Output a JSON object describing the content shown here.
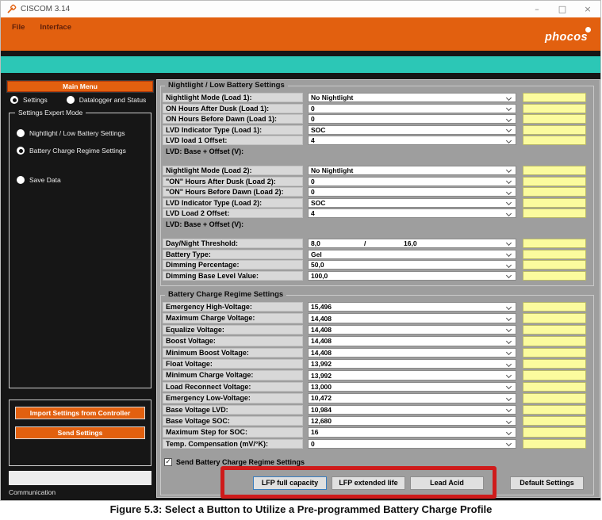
{
  "window": {
    "title": "CISCOM 3.14"
  },
  "titlebar_controls": {
    "minimize": "–",
    "maximize": "□",
    "close": "×"
  },
  "menubar": {
    "items": [
      "File",
      "Interface"
    ],
    "logo_text": "phocos"
  },
  "colors": {
    "accent_orange": "#e2600f",
    "teal": "#2cc7b6",
    "annotation_red": "#cf1b1b",
    "indicator_yellow": "#fbfb9e"
  },
  "sidebar": {
    "main_menu_label": "Main Menu",
    "mode_radios": [
      {
        "label": "Settings",
        "selected": true
      },
      {
        "label": "Datalogger and Status",
        "selected": false
      }
    ],
    "expert_group": {
      "title": "Settings Expert Mode",
      "radios": [
        {
          "label": "Nightlight / Low Battery Settings",
          "selected": false
        },
        {
          "label": "Battery Charge Regime Settings",
          "selected": true
        },
        {
          "label": "Save Data",
          "selected": false
        }
      ]
    },
    "action_buttons": [
      "Import Settings from Controller",
      "Send Settings"
    ],
    "communication_label": "Communication"
  },
  "main": {
    "group1": {
      "title": "Nightlight / Low Battery Settings",
      "sections": [
        {
          "rows": [
            {
              "label": "Nightlight Mode (Load 1):",
              "value": "No Nightlight"
            },
            {
              "label": "ON Hours After Dusk (Load 1):",
              "value": "0"
            },
            {
              "label": "ON Hours Before Dawn (Load 1):",
              "value": "0"
            },
            {
              "label": "LVD Indicator Type (Load 1):",
              "value": "SOC"
            },
            {
              "label": "LVD load 1 Offset:",
              "value": "4"
            },
            {
              "label": "LVD: Base + Offset (V):",
              "plain": true
            }
          ]
        },
        {
          "rows": [
            {
              "label": "Nightlight Mode (Load 2):",
              "value": "No Nightlight"
            },
            {
              "label": "\"ON\" Hours After Dusk (Load 2):",
              "value": "0"
            },
            {
              "label": "\"ON\" Hours Before Dawn (Load 2):",
              "value": "0"
            },
            {
              "label": "LVD Indicator Type (Load 2):",
              "value": "SOC"
            },
            {
              "label": "LVD Load 2 Offset:",
              "value": "4"
            },
            {
              "label": "LVD: Base + Offset (V):",
              "plain": true
            }
          ]
        },
        {
          "rows": [
            {
              "label": "Day/Night Threshold:",
              "value": "8,0",
              "sep": "/",
              "value2": "16,0"
            },
            {
              "label": "Battery Type:",
              "value": "Gel"
            },
            {
              "label": "Dimming Percentage:",
              "value": "50,0"
            },
            {
              "label": "Dimming Base Level Value:",
              "value": "100,0"
            }
          ]
        }
      ]
    },
    "group2": {
      "title": "Battery Charge Regime Settings",
      "sections": [
        {
          "rows": [
            {
              "label": "Emergency High-Voltage:",
              "value": "15,496"
            },
            {
              "label": "Maximum Charge Voltage:",
              "value": "14,408"
            },
            {
              "label": "Equalize Voltage:",
              "value": "14,408"
            },
            {
              "label": "Boost Voltage:",
              "value": "14,408"
            },
            {
              "label": "Minimum Boost Voltage:",
              "value": "14,408"
            },
            {
              "label": "Float Voltage:",
              "value": "13,992"
            },
            {
              "label": "Minimum Charge Voltage:",
              "value": "13,992"
            },
            {
              "label": "Load Reconnect Voltage:",
              "value": "13,000"
            },
            {
              "label": "Emergency Low-Voltage:",
              "value": "10,472"
            },
            {
              "label": "Base Voltage LVD:",
              "value": "10,984"
            },
            {
              "label": "Base Voltage SOC:",
              "value": "12,680"
            },
            {
              "label": "Maximum Step for SOC:",
              "value": "16"
            },
            {
              "label": "Temp. Compensation (mV/°K):",
              "value": "0"
            }
          ]
        }
      ],
      "checkbox": {
        "label": "Send Battery Charge Regime Settings",
        "checked": true,
        "check_glyph": "✓"
      },
      "profile_buttons": [
        {
          "label": "LFP full capacity",
          "focused": true
        },
        {
          "label": "LFP extended life",
          "focused": false
        },
        {
          "label": "Lead Acid",
          "focused": false
        }
      ],
      "default_button": "Default Settings"
    }
  },
  "caption": "Figure 5.3: Select a Button to Utilize a Pre-programmed Battery Charge Profile"
}
